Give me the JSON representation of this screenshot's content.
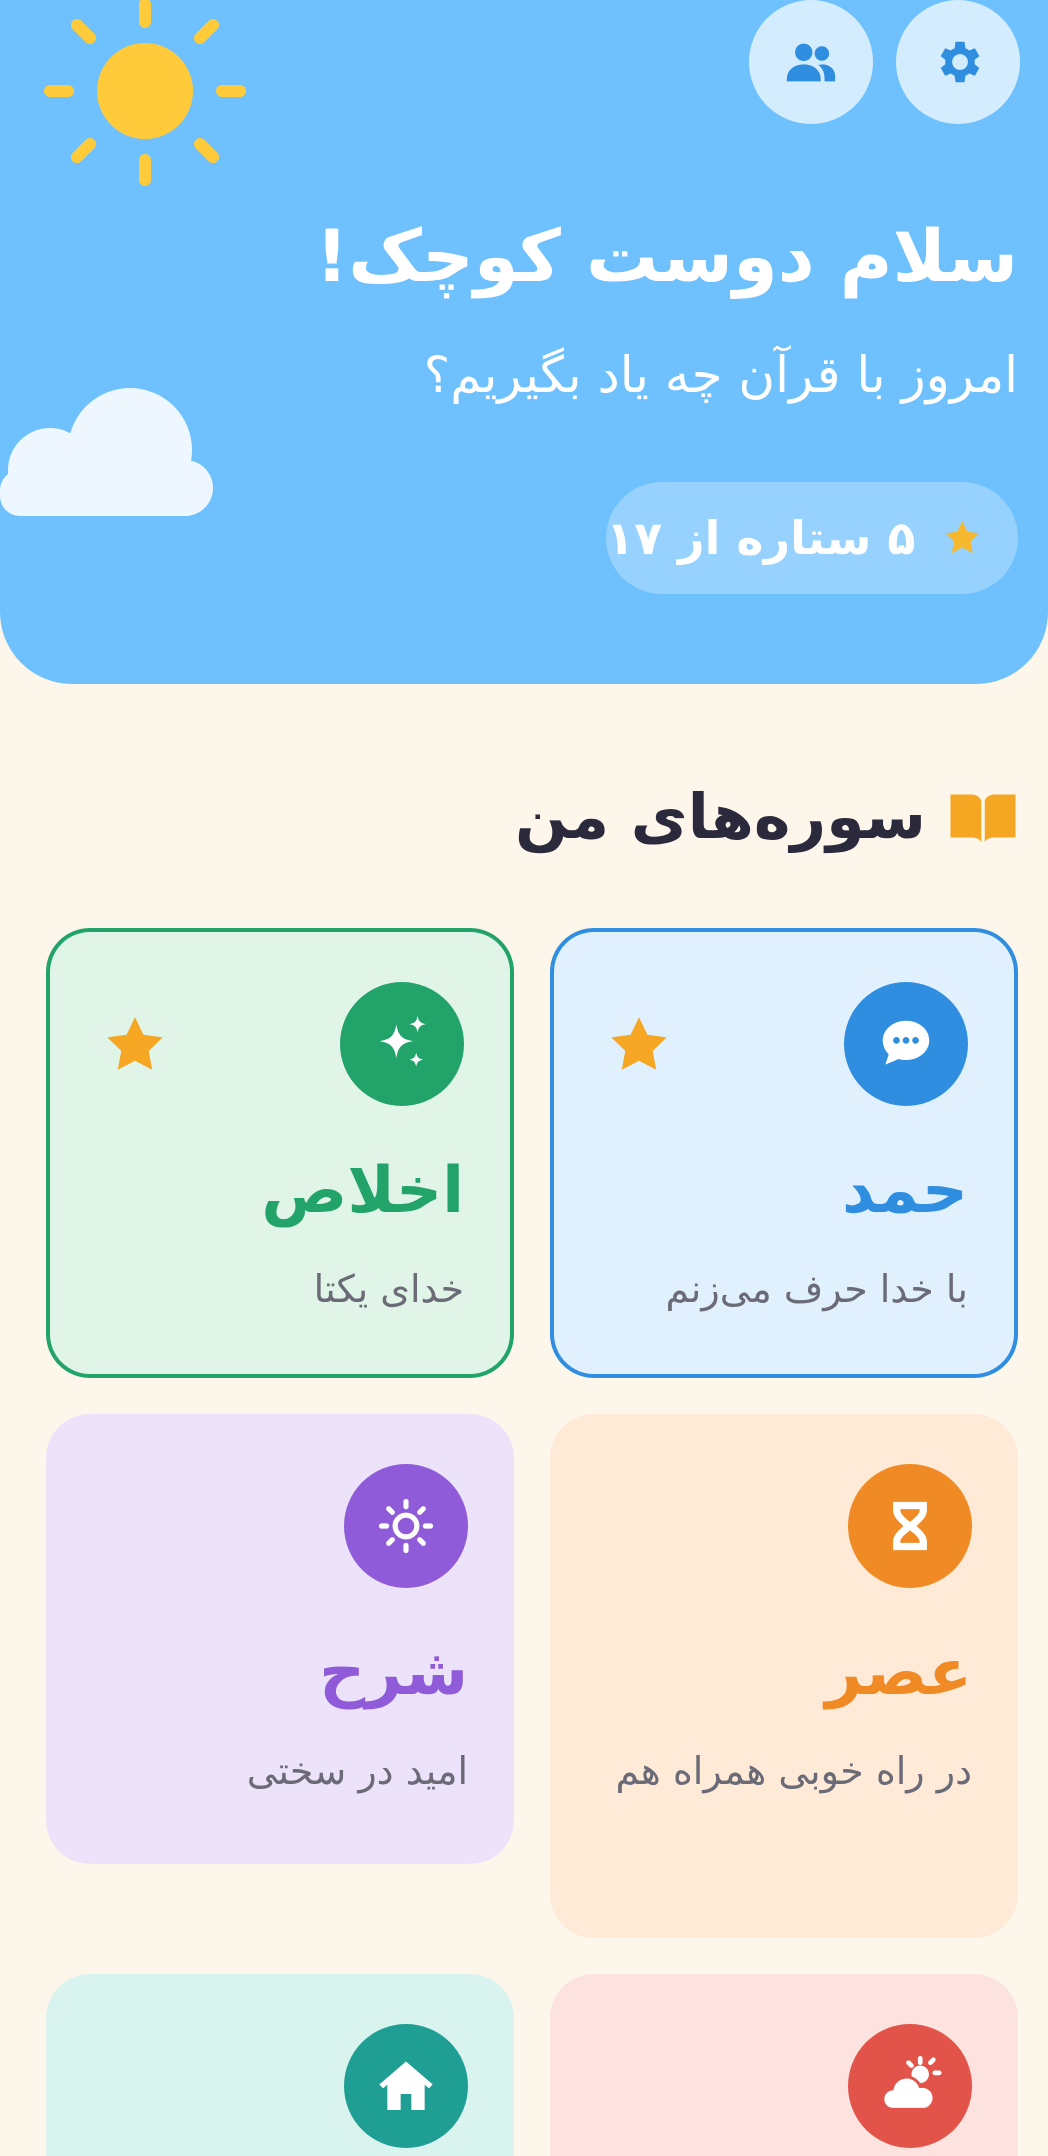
{
  "header": {
    "greeting_title": "سلام دوست کوچک!",
    "greeting_subtitle": "امروز با قرآن چه یاد بگیریم؟",
    "stars_label": "۵ ستاره از ۱۷",
    "stars_earned": 5,
    "stars_total": 17,
    "settings_icon": "gear-icon",
    "parents_icon": "users-icon"
  },
  "section": {
    "title": "سوره‌های من",
    "icon": "open-book-icon"
  },
  "surahs": [
    {
      "name": "حمد",
      "desc": "با خدا حرف می‌زنم",
      "icon": "chat-bubble-icon",
      "color": "#2f8ee0",
      "bg": "#e1f0fd",
      "starred": true,
      "selected": true
    },
    {
      "name": "اخلاص",
      "desc": "خدای یکتا",
      "icon": "sparkles-icon",
      "color": "#22a36a",
      "bg": "#e0f4e7",
      "starred": true,
      "selected": true
    },
    {
      "name": "عصر",
      "desc": "در راه خوبی همراه هم",
      "icon": "hourglass-icon",
      "color": "#f08a24",
      "bg": "#feead7",
      "starred": false,
      "selected": false
    },
    {
      "name": "شرح",
      "desc": "امید در سختی",
      "icon": "sun-icon",
      "color": "#8f5bd9",
      "bg": "#ece3fa",
      "starred": false,
      "selected": false
    },
    {
      "name": "",
      "desc": "",
      "icon": "cloud-sun-icon",
      "color": "#e2534a",
      "bg": "#fde3e0",
      "starred": false,
      "selected": false
    },
    {
      "name": "",
      "desc": "",
      "icon": "home-icon",
      "color": "#1f9e94",
      "bg": "#d9f3ef",
      "starred": false,
      "selected": false
    }
  ],
  "colors": {
    "header_bg": "#6ec1fc",
    "page_bg": "#fdf6ea",
    "star": "#f5a623"
  }
}
